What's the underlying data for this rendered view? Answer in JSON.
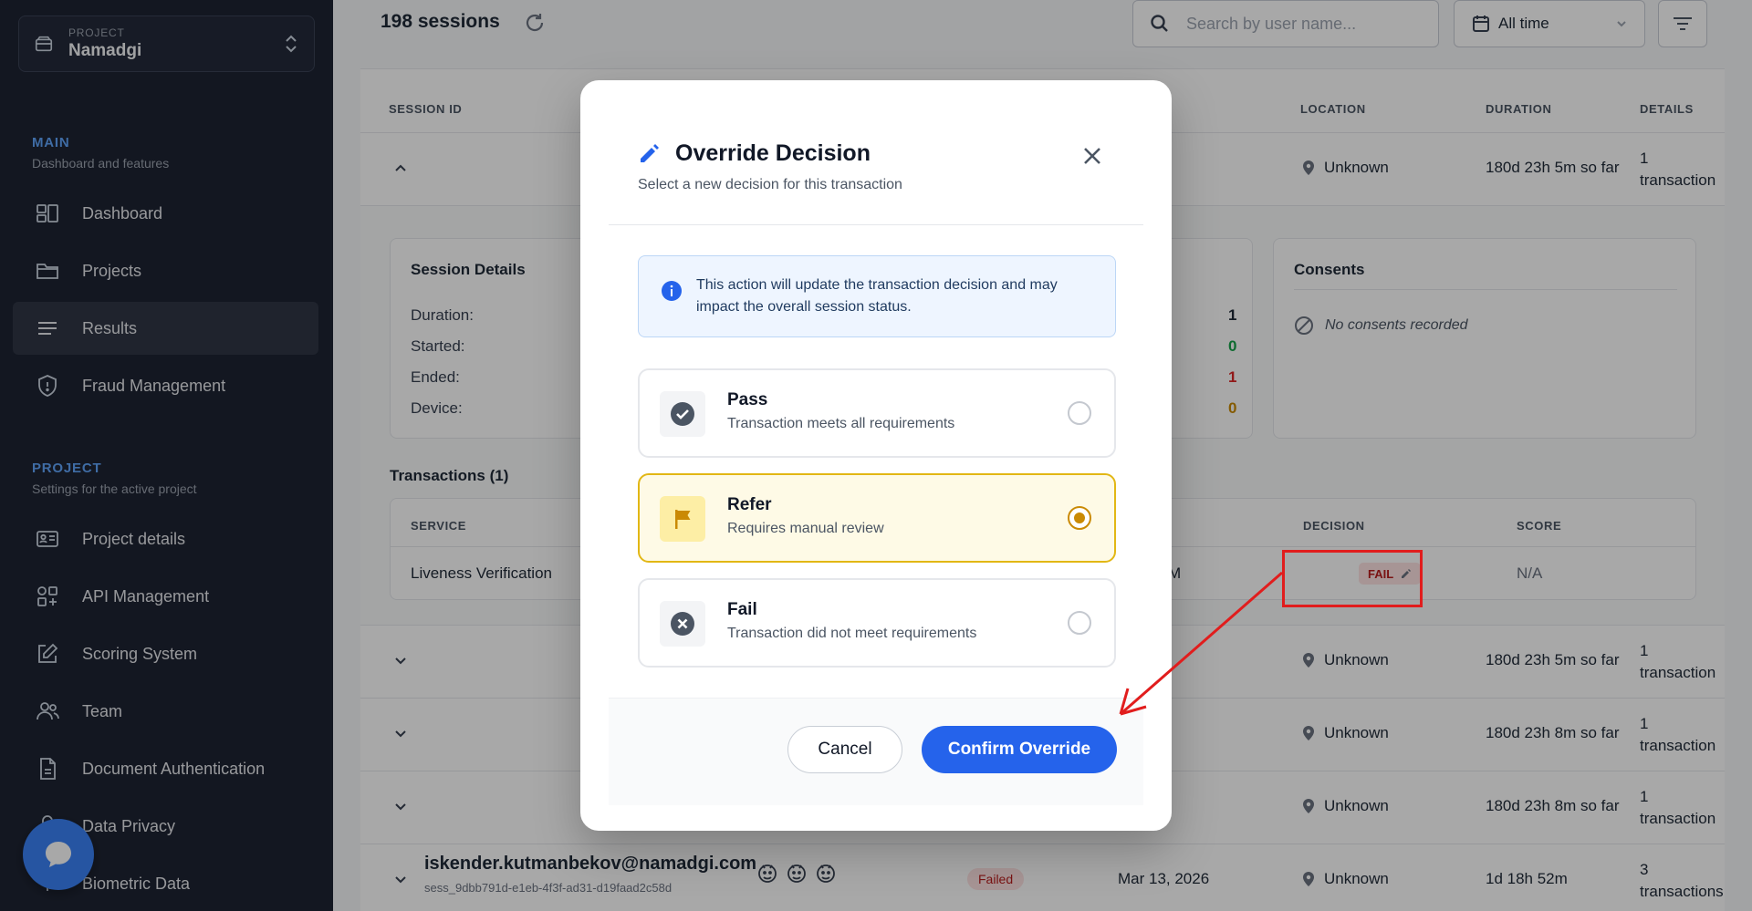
{
  "sidebar": {
    "project_kicker": "PROJECT",
    "project_name": "Namadgi",
    "main_heading": "MAIN",
    "main_sub": "Dashboard and features",
    "main_items": [
      {
        "label": "Dashboard",
        "icon": "dashboard-icon"
      },
      {
        "label": "Projects",
        "icon": "folder-icon"
      },
      {
        "label": "Results",
        "icon": "list-icon",
        "active": true
      },
      {
        "label": "Fraud Management",
        "icon": "shield-icon"
      }
    ],
    "project_heading": "PROJECT",
    "project_sub": "Settings for the active project",
    "project_items": [
      {
        "label": "Project details",
        "icon": "id-card-icon"
      },
      {
        "label": "API Management",
        "icon": "api-grid-icon"
      },
      {
        "label": "Scoring System",
        "icon": "edit-icon"
      },
      {
        "label": "Team",
        "icon": "team-icon"
      },
      {
        "label": "Document Authentication",
        "icon": "document-icon"
      },
      {
        "label": "Data Privacy",
        "icon": "lock-icon"
      },
      {
        "label": "Biometric Data",
        "icon": "fingerprint-icon"
      }
    ]
  },
  "topbar": {
    "sessions_count": "198 sessions",
    "search_placeholder": "Search by user name...",
    "time_filter": "All time"
  },
  "table": {
    "headers": {
      "session_id": "SESSION ID",
      "location": "LOCATION",
      "duration": "DURATION",
      "details": "DETAILS"
    },
    "rows": [
      {
        "location": "Unknown",
        "duration": "180d 23h 5m so far",
        "details_count": "1",
        "details_unit": "transaction"
      },
      {
        "location": "Unknown",
        "duration": "180d 23h 5m so far",
        "details_count": "1",
        "details_unit": "transaction"
      },
      {
        "location": "Unknown",
        "duration": "180d 23h 8m so far",
        "details_count": "1",
        "details_unit": "transaction"
      },
      {
        "location": "Unknown",
        "duration": "180d 23h 8m so far",
        "details_count": "1",
        "details_unit": "transaction"
      }
    ],
    "last_row": {
      "email": "iskender.kutmanbekov@namadgi.com",
      "session_id": "sess_9dbb791d-e1eb-4f3f-ad31-d19faad2c58d",
      "status": "Failed",
      "date": "Mar 13, 2026",
      "location": "Unknown",
      "duration": "1d 18h 52m",
      "details_count": "3",
      "details_unit": "transactions"
    }
  },
  "expanded": {
    "session_details_title": "Session Details",
    "labels": [
      "Duration:",
      "Started:",
      "Ended:",
      "Device:"
    ],
    "counts": [
      {
        "value": "1",
        "color": "#1f2937"
      },
      {
        "value": "0",
        "color": "#16a34a"
      },
      {
        "value": "1",
        "color": "#dc2626"
      },
      {
        "value": "0",
        "color": "#ca8a04"
      }
    ],
    "consents_title": "Consents",
    "consents_empty": "No consents recorded",
    "transactions_title": "Transactions (1)",
    "tx_headers": {
      "service": "SERVICE",
      "decision": "DECISION",
      "score": "SCORE"
    },
    "tx_row": {
      "service": "Liveness Verification",
      "time_suffix": "M",
      "decision": "FAIL",
      "score": "N/A"
    }
  },
  "modal": {
    "title": "Override Decision",
    "subtitle": "Select a new decision for this transaction",
    "info": "This action will update the transaction decision and may impact the overall session status.",
    "options": [
      {
        "title": "Pass",
        "desc": "Transaction meets all requirements",
        "selected": false
      },
      {
        "title": "Refer",
        "desc": "Requires manual review",
        "selected": true
      },
      {
        "title": "Fail",
        "desc": "Transaction did not meet requirements",
        "selected": false
      }
    ],
    "cancel_label": "Cancel",
    "confirm_label": "Confirm Override"
  },
  "colors": {
    "sidebar_bg": "#1e2433",
    "accent_blue": "#2563eb",
    "refer_yellow": "#e2b715",
    "annotation_red": "#e11d1d"
  }
}
